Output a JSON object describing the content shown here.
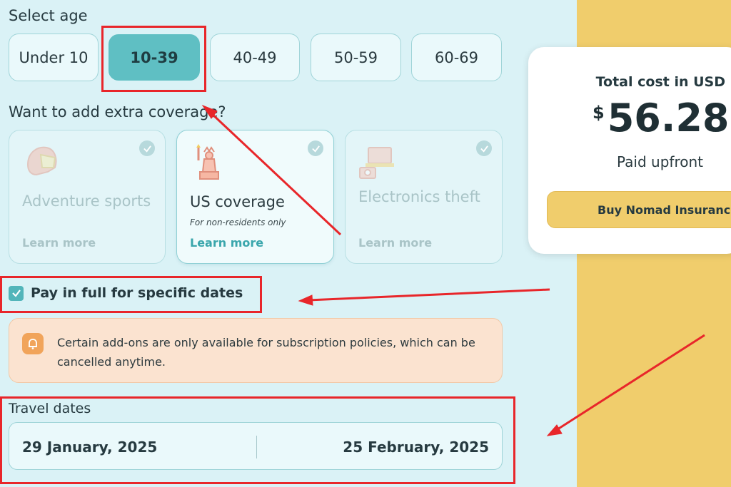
{
  "age": {
    "label": "Select age",
    "options": [
      "Under 10",
      "10-39",
      "40-49",
      "50-59",
      "60-69"
    ],
    "selected": "10-39"
  },
  "coverage": {
    "label": "Want to add extra coverage?",
    "cards": [
      {
        "title": "Adventure sports",
        "subtitle": "",
        "learn_more": "Learn more",
        "icon": "helmet-icon",
        "active": false
      },
      {
        "title": "US coverage",
        "subtitle": "For non-residents only",
        "learn_more": "Learn more",
        "icon": "statue-of-liberty-icon",
        "active": true
      },
      {
        "title": "Electronics theft",
        "subtitle": "",
        "learn_more": "Learn more",
        "icon": "electronics-icon",
        "active": false
      }
    ]
  },
  "payment": {
    "checkbox_label": "Pay in full for specific dates",
    "checked": true
  },
  "notice": {
    "text": "Certain add-ons are only available for subscription policies, which can be cancelled anytime.",
    "icon": "bell-icon"
  },
  "travel_dates": {
    "label": "Travel dates",
    "start": "29 January, 2025",
    "end": "25 February, 2025"
  },
  "summary": {
    "label": "Total cost in USD",
    "currency_symbol": "$",
    "amount": "56.28",
    "payment_note": "Paid upfront",
    "buy_button": "Buy Nomad Insurance"
  },
  "colors": {
    "accent_teal": "#5fbfc3",
    "panel_yellow": "#f0cd6c",
    "annotation_red": "#e8262a"
  }
}
